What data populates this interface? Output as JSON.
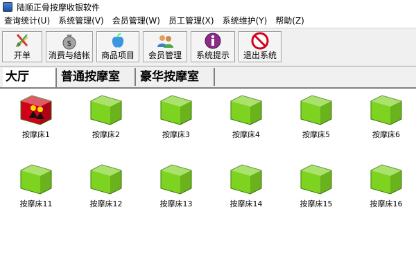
{
  "window": {
    "title": "陆顺正骨按摩收银软件"
  },
  "menu": [
    {
      "label": "查询统计(U)"
    },
    {
      "label": "系统管理(V)"
    },
    {
      "label": "会员管理(W)"
    },
    {
      "label": "员工管理(X)"
    },
    {
      "label": "系统维护(Y)"
    },
    {
      "label": "帮助(Z)"
    }
  ],
  "toolbar": [
    {
      "label": "开单",
      "icon": "pen-order-icon"
    },
    {
      "label": "消费与结帐",
      "icon": "money-bag-icon"
    },
    {
      "label": "商品项目",
      "icon": "apple-icon"
    },
    {
      "label": "会员管理",
      "icon": "members-icon"
    },
    {
      "label": "系统提示",
      "icon": "info-icon"
    },
    {
      "label": "退出系统",
      "icon": "no-entry-icon"
    }
  ],
  "tabs": [
    {
      "label": "大厅",
      "active": true
    },
    {
      "label": "普通按摩室",
      "active": false
    },
    {
      "label": "豪华按摩室",
      "active": false
    }
  ],
  "beds": [
    {
      "label": "按摩床1",
      "status": "occupied"
    },
    {
      "label": "按摩床2",
      "status": "free"
    },
    {
      "label": "按摩床3",
      "status": "free"
    },
    {
      "label": "按摩床4",
      "status": "free"
    },
    {
      "label": "按摩床5",
      "status": "free"
    },
    {
      "label": "按摩床6",
      "status": "free"
    },
    {
      "label": "按摩床11",
      "status": "free"
    },
    {
      "label": "按摩床12",
      "status": "free"
    },
    {
      "label": "按摩床13",
      "status": "free"
    },
    {
      "label": "按摩床14",
      "status": "free"
    },
    {
      "label": "按摩床15",
      "status": "free"
    },
    {
      "label": "按摩床16",
      "status": "free"
    }
  ],
  "colors": {
    "free": "#7ed321",
    "occupied": "#d0021b"
  }
}
